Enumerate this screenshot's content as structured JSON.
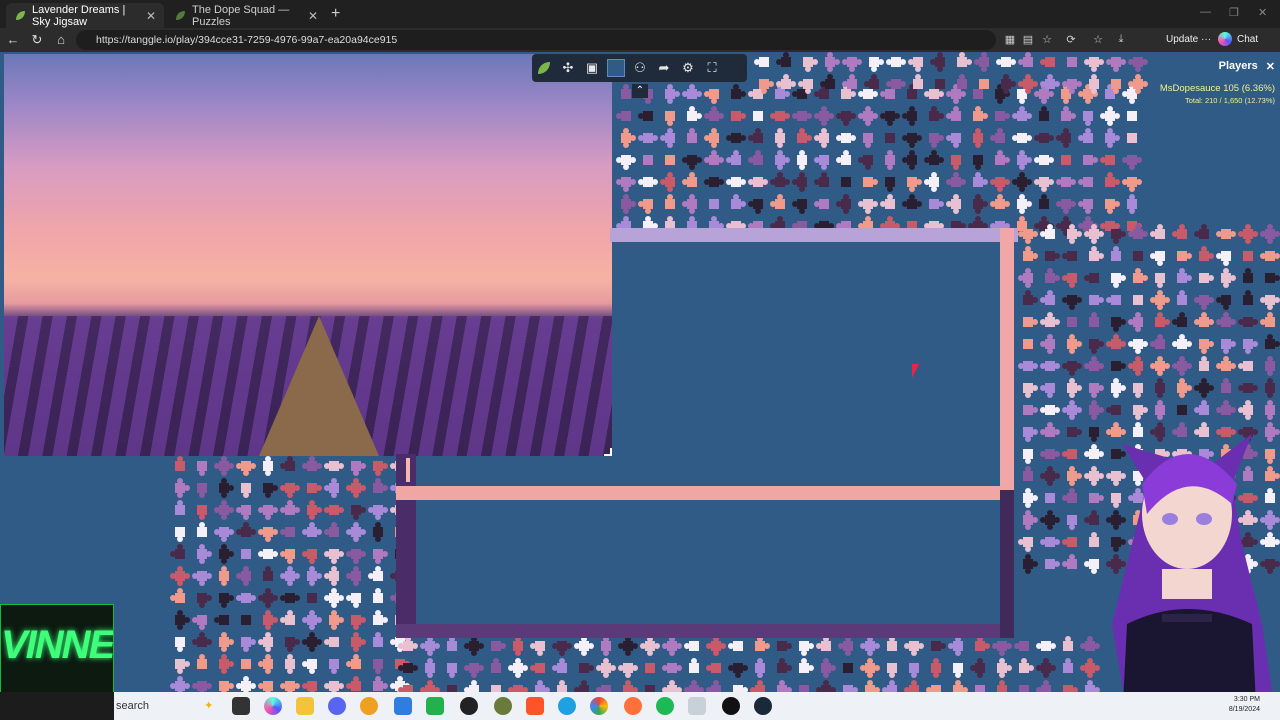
{
  "browser": {
    "tabs": [
      {
        "title": "Lavender Dreams | Sky Jigsaw",
        "active": true
      },
      {
        "title": "The Dope Squad — Puzzles",
        "active": false
      }
    ],
    "new_tab": "+",
    "url": "https://tanggle.io/play/394cce31-7259-4976-99a7-ea20a94ce915",
    "update_label": "Update",
    "update_more": "···",
    "chat_label": "Chat"
  },
  "game": {
    "players_title": "Players",
    "player": {
      "name": "MsDopesauce",
      "score": "105 (6.36%)"
    },
    "total": "Total: 210 / 1,650 (12.73%)",
    "tools": [
      "logo-icon",
      "puzzle-icon",
      "image-icon",
      "box-icon",
      "users-icon",
      "share-icon",
      "settings-icon",
      "fullscreen-icon"
    ],
    "colors": {
      "board": "#2f5b86",
      "toolbar": "#1f2a3a",
      "highlight": "#f5f08a"
    }
  },
  "overlay": {
    "logo_text": "VINNE"
  },
  "taskbar": {
    "search_placeholder": "search",
    "time": "3:30 PM",
    "date": "8/19/2024"
  }
}
